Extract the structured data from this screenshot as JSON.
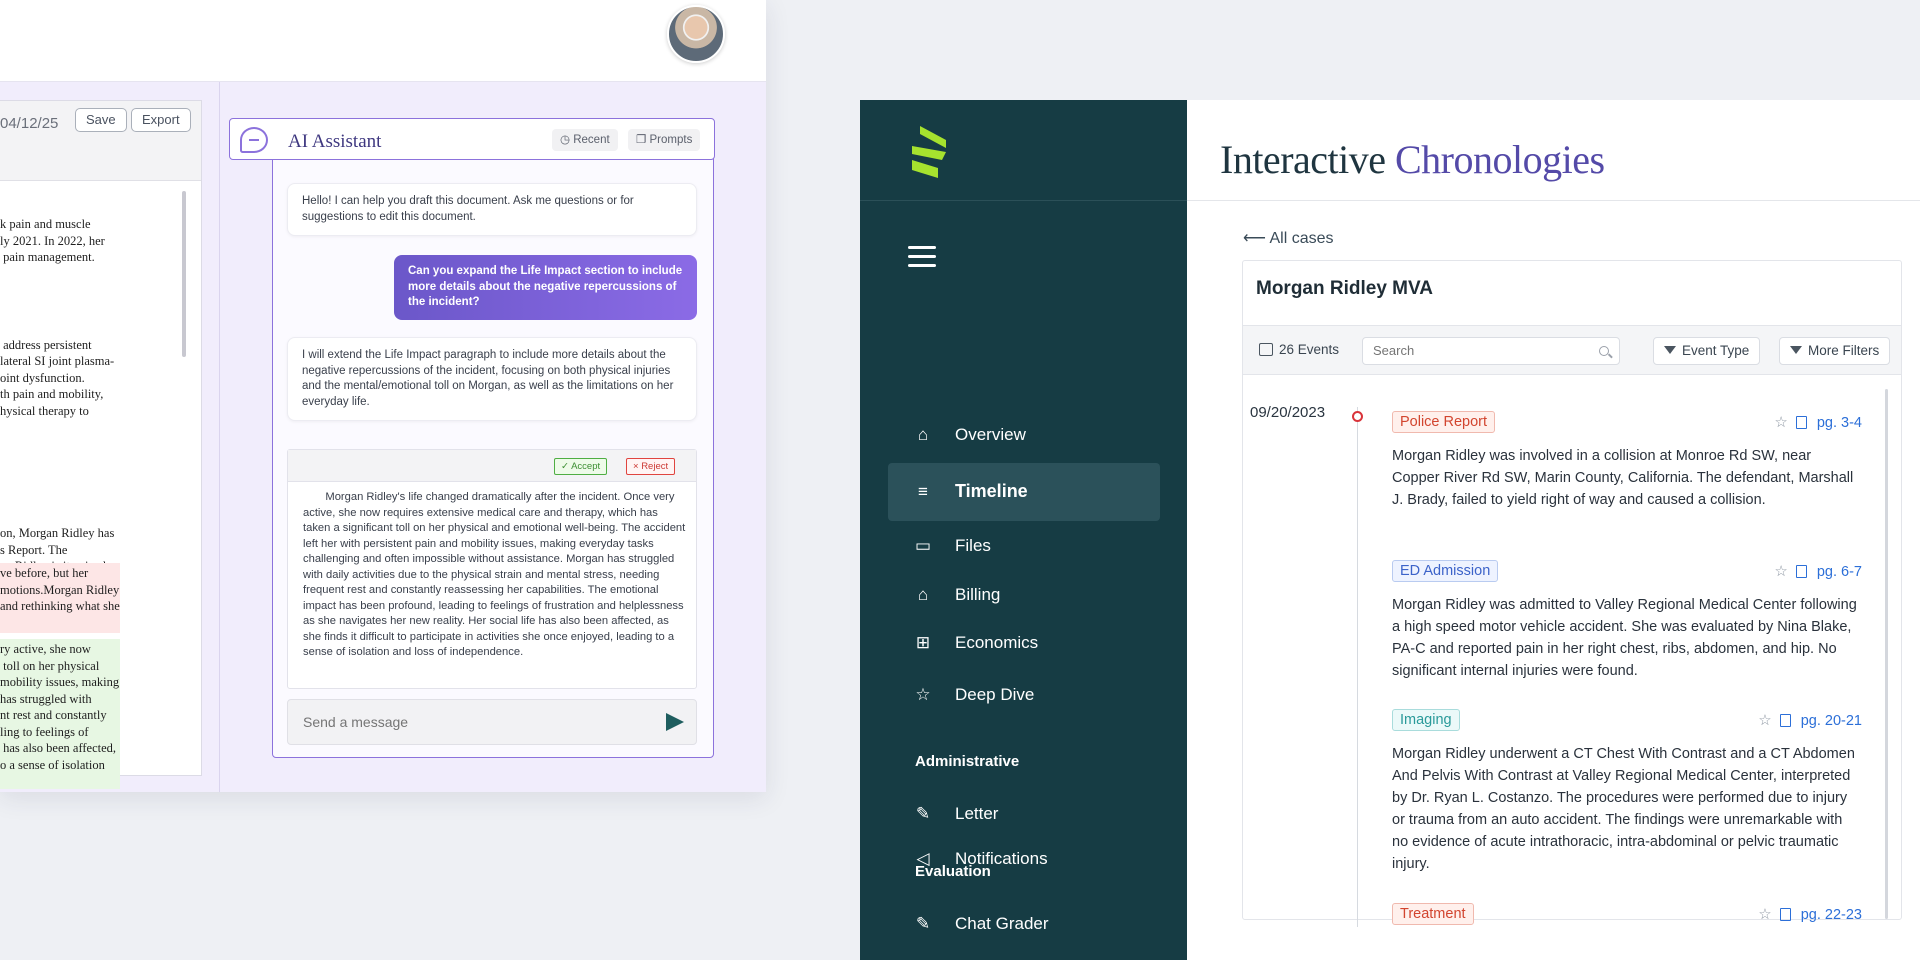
{
  "left_window": {
    "doc": {
      "date": "04/12/25",
      "save_label": "Save",
      "export_label": "Export",
      "paragraphs": [
        "k pain and muscle\nly 2021. In 2022, her\n pain management.",
        " address persistent\nlateral SI joint plasma-\noint dysfunction.\nth pain and mobility,\nhysical therapy to",
        "on, Morgan Ridley has\ns Report. The\nan Ridley is itemized"
      ],
      "red_highlight": "ve before, but her\nmotions.Morgan Ridley\nand rethinking what she",
      "green_highlight": "ry active, she now\n toll on her physical\nmobility issues, making\nhas struggled with\nnt rest and constantly\nling to feelings of\n has also been affected,\no a sense of isolation"
    },
    "assistant": {
      "title": "AI Assistant",
      "recent_label": "Recent",
      "prompts_label": "Prompts",
      "greeting": "Hello! I can help you draft this document. Ask me questions or for suggestions to edit this document.",
      "user_message": "Can you expand the Life Impact section to include more details about the negative repercussions of the incident?",
      "reply": "I will extend the Life Impact paragraph to include more details about the negative repercussions of the incident, focusing on both physical injuries and the mental/emotional toll on Morgan, as well as the limitations on her everyday life.",
      "accept_label": "Accept",
      "reject_label": "Reject",
      "draft": "Morgan Ridley's life changed dramatically after the incident. Once very active, she now requires extensive medical care and therapy, which has taken a significant toll on her physical and emotional well-being. The accident left her with persistent pain and mobility issues, making everyday tasks challenging and often impossible without assistance. Morgan has struggled with daily activities due to the physical strain and mental stress, needing frequent rest and constantly reassessing her capabilities. The emotional impact has been profound, leading to feelings of frustration and helplessness as she navigates her new reality. Her social life has also been affected, as she finds it difficult to participate in activities she once enjoyed, leading to a sense of isolation and loss of independence.",
      "input_placeholder": "Send a message"
    }
  },
  "right_window": {
    "sidebar": {
      "items": [
        {
          "label": "Overview",
          "icon": "home-icon"
        },
        {
          "label": "Timeline",
          "icon": "timeline-icon"
        },
        {
          "label": "Files",
          "icon": "folder-icon"
        },
        {
          "label": "Billing",
          "icon": "bank-icon"
        },
        {
          "label": "Economics",
          "icon": "calculator-icon"
        },
        {
          "label": "Deep Dive",
          "icon": "pin-icon"
        }
      ],
      "admin_heading": "Administrative",
      "admin_items": [
        {
          "label": "Letter",
          "icon": "pen-icon"
        },
        {
          "label": "Notifications",
          "icon": "megaphone-icon"
        }
      ],
      "eval_heading": "Evaluation",
      "eval_items": [
        {
          "label": "Chat Grader",
          "icon": "edit-icon"
        }
      ],
      "accent_color": "#163c44"
    },
    "main": {
      "title_part1": "Interactive",
      "title_part2": "Chronologies",
      "back_label": "All cases",
      "case_title": "Morgan Ridley MVA",
      "events_count": "26 Events",
      "search_placeholder": "Search",
      "event_type_label": "Event Type",
      "more_filters_label": "More Filters",
      "date": "09/20/2023",
      "events": [
        {
          "tag": "Police Report",
          "pages": "pg. 3-4",
          "text": "Morgan Ridley was involved in a collision at Monroe Rd SW, near Copper River Rd SW, Marin County, California. The defendant, Marshall J. Brady, failed to yield right of way and caused a collision."
        },
        {
          "tag": "ED Admission",
          "pages": "pg. 6-7",
          "text": "Morgan Ridley was admitted to Valley Regional Medical Center following a high speed motor vehicle accident. She was evaluated by Nina Blake, PA-C and reported pain in her right chest, ribs, abdomen, and hip. No significant internal injuries were found."
        },
        {
          "tag": "Imaging",
          "pages": "pg. 20-21",
          "text": "Morgan Ridley underwent a CT Chest With Contrast and a CT Abdomen And Pelvis With Contrast at Valley Regional Medical Center, interpreted by Dr. Ryan L. Costanzo. The procedures were performed due to injury or trauma from an auto accident. The findings were unremarkable with no evidence of acute intrathoracic, intra-abdominal or pelvic traumatic injury."
        },
        {
          "tag": "Treatment",
          "pages": "pg. 22-23",
          "text": ""
        }
      ]
    }
  }
}
